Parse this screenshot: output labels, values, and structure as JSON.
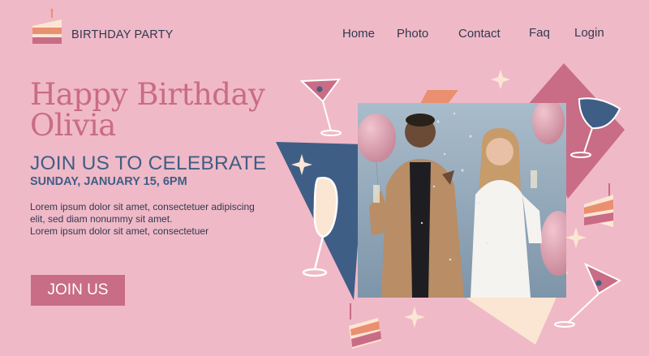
{
  "header": {
    "brand": "BIRTHDAY PARTY",
    "logo_icon": "birthday-cake-icon",
    "nav": [
      {
        "label": "Home"
      },
      {
        "label": "Photo"
      },
      {
        "label": "Contact"
      },
      {
        "label": "Faq"
      },
      {
        "label": "Login"
      }
    ]
  },
  "hero": {
    "title_line1": "Happy Birthday",
    "title_line2": "Olivia",
    "subtitle": "JOIN US TO CELEBRATE",
    "date": "SUNDAY, JANUARY 15, 6PM",
    "body_line1": "Lorem ipsum dolor sit amet, consectetuer adipiscing",
    "body_line2": "elit, sed diam nonummy sit amet.",
    "body_line3": "Lorem ipsum dolor sit amet, consectetuer",
    "cta_label": "JOIN US"
  },
  "colors": {
    "background": "#f0b9c7",
    "accent_pink": "#c96c86",
    "navy": "#3f5e86",
    "text_dark": "#2f3a4f",
    "cream": "#fbe6d3",
    "orange": "#ea8f6f"
  },
  "photo": {
    "subject": "couple celebrating with champagne glasses and balloons"
  }
}
